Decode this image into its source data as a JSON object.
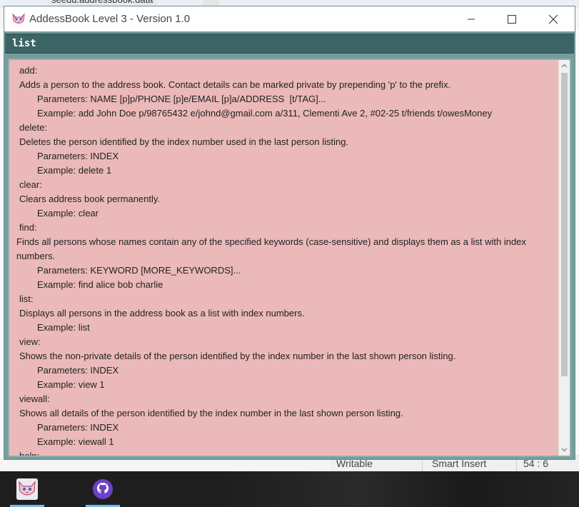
{
  "window": {
    "title": "AddessBook Level 3 - Version 1.0",
    "controls": {
      "minimize": "minimize",
      "maximize": "maximize",
      "close": "close"
    }
  },
  "background": {
    "ide_tab": "seedu.addressbook.data",
    "status": {
      "writable": "Writable",
      "insert_mode": "Smart Insert",
      "position": "54 : 6"
    }
  },
  "command_box": {
    "value": "list"
  },
  "result_display": {
    "lines": [
      {
        "text": "add:",
        "style": "cmd"
      },
      {
        "text": "Adds a person to the address book. Contact details can be marked private by prepending 'p' to the prefix.",
        "style": "desc"
      },
      {
        "text": "Parameters: NAME [p]p/PHONE [p]e/EMAIL [p]a/ADDRESS  [t/TAG]...",
        "style": "indent"
      },
      {
        "text": "Example: add John Doe p/98765432 e/johnd@gmail.com a/311, Clementi Ave 2, #02-25 t/friends t/owesMoney",
        "style": "indent"
      },
      {
        "text": "delete:",
        "style": "cmd"
      },
      {
        "text": "Deletes the person identified by the index number used in the last person listing.",
        "style": "desc"
      },
      {
        "text": "Parameters: INDEX",
        "style": "indent"
      },
      {
        "text": "Example: delete 1",
        "style": "indent"
      },
      {
        "text": "clear:",
        "style": "cmd"
      },
      {
        "text": "Clears address book permanently.",
        "style": "desc"
      },
      {
        "text": "Example: clear",
        "style": "indent"
      },
      {
        "text": "find:",
        "style": "cmd"
      },
      {
        "text": "Finds all persons whose names contain any of the specified keywords (case-sensitive) and displays them as a list with index numbers.",
        "style": "wrap"
      },
      {
        "text": "Parameters: KEYWORD [MORE_KEYWORDS]...",
        "style": "indent"
      },
      {
        "text": "Example: find alice bob charlie",
        "style": "indent"
      },
      {
        "text": "list:",
        "style": "cmd"
      },
      {
        "text": "Displays all persons in the address book as a list with index numbers.",
        "style": "desc"
      },
      {
        "text": "Example: list",
        "style": "indent"
      },
      {
        "text": "view:",
        "style": "cmd"
      },
      {
        "text": "Shows the non-private details of the person identified by the index number in the last shown person listing.",
        "style": "desc"
      },
      {
        "text": "Parameters: INDEX",
        "style": "indent"
      },
      {
        "text": "Example: view 1",
        "style": "indent"
      },
      {
        "text": "viewall:",
        "style": "cmd"
      },
      {
        "text": "Shows all details of the person identified by the index number in the last shown person listing.",
        "style": "desc"
      },
      {
        "text": "Parameters: INDEX",
        "style": "indent"
      },
      {
        "text": "Example: viewall 1",
        "style": "indent"
      },
      {
        "text": "help:",
        "style": "cmd"
      }
    ]
  },
  "taskbar": {
    "items": [
      {
        "name": "addressbook-app",
        "icon": "fox-icon"
      },
      {
        "name": "github-desktop",
        "icon": "github-icon"
      }
    ]
  },
  "colors": {
    "command_bar": "#3c6464",
    "window_frame": "#759d9d",
    "result_background": "#ebb9b9",
    "taskbar": "#1e1e1e",
    "taskbar_active": "#76b9ed"
  }
}
